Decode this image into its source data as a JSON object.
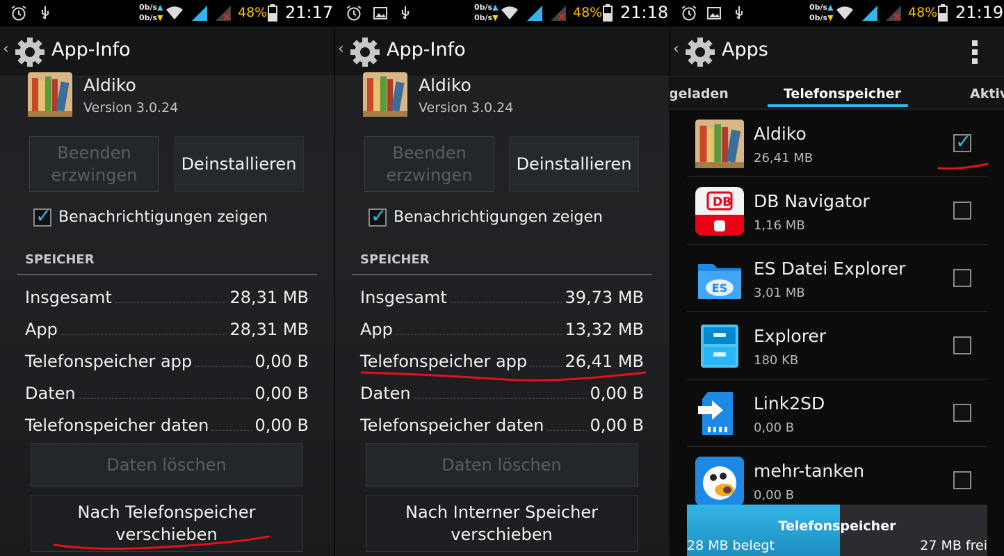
{
  "status": {
    "net_up": "0b/s",
    "net_down": "0b/s",
    "battery": "48%",
    "times": [
      "21:17",
      "21:18",
      "21:19"
    ]
  },
  "screen1": {
    "title": "App-Info",
    "app_name": "Aldiko",
    "app_version": "Version 3.0.24",
    "btn_force_stop": "Beenden erzwingen",
    "btn_uninstall": "Deinstallieren",
    "notifications_label": "Benachrichtigungen zeigen",
    "section_title": "SPEICHER",
    "rows": [
      {
        "label": "Insgesamt",
        "value": "28,31 MB"
      },
      {
        "label": "App",
        "value": "28,31 MB"
      },
      {
        "label": "Telefonspeicher app",
        "value": "0,00 B"
      },
      {
        "label": "Daten",
        "value": "0,00 B"
      },
      {
        "label": "Telefonspeicher daten",
        "value": "0,00 B"
      }
    ],
    "btn_clear_data": "Daten löschen",
    "btn_move": "Nach Telefonspeicher verschieben"
  },
  "screen2": {
    "title": "App-Info",
    "app_name": "Aldiko",
    "app_version": "Version 3.0.24",
    "btn_force_stop": "Beenden erzwingen",
    "btn_uninstall": "Deinstallieren",
    "notifications_label": "Benachrichtigungen zeigen",
    "section_title": "SPEICHER",
    "rows": [
      {
        "label": "Insgesamt",
        "value": "39,73 MB"
      },
      {
        "label": "App",
        "value": "13,32 MB"
      },
      {
        "label": "Telefonspeicher app",
        "value": "26,41 MB"
      },
      {
        "label": "Daten",
        "value": "0,00 B"
      },
      {
        "label": "Telefonspeicher daten",
        "value": "0,00 B"
      }
    ],
    "btn_clear_data": "Daten löschen",
    "btn_move": "Nach Interner Speicher verschieben"
  },
  "screen3": {
    "title": "Apps",
    "tabs": [
      "geladen",
      "Telefonspeicher",
      "Aktiv"
    ],
    "apps": [
      {
        "name": "Aldiko",
        "size": "26,41 MB",
        "checked": true
      },
      {
        "name": "DB Navigator",
        "size": "1,16 MB",
        "checked": false
      },
      {
        "name": "ES Datei Explorer",
        "size": "3,01 MB",
        "checked": false
      },
      {
        "name": "Explorer",
        "size": "180 KB",
        "checked": false
      },
      {
        "name": "Link2SD",
        "size": "0,00 B",
        "checked": false
      },
      {
        "name": "mehr-tanken",
        "size": "0,00 B",
        "checked": false
      }
    ],
    "db_logo_text": "DB",
    "storage_title": "Telefonspeicher",
    "storage_used": "28 MB belegt",
    "storage_free": "27 MB frei",
    "storage_used_fraction": 0.51
  },
  "colors": {
    "accent": "#33b5e5",
    "highlight_pen": "#e8101a"
  }
}
